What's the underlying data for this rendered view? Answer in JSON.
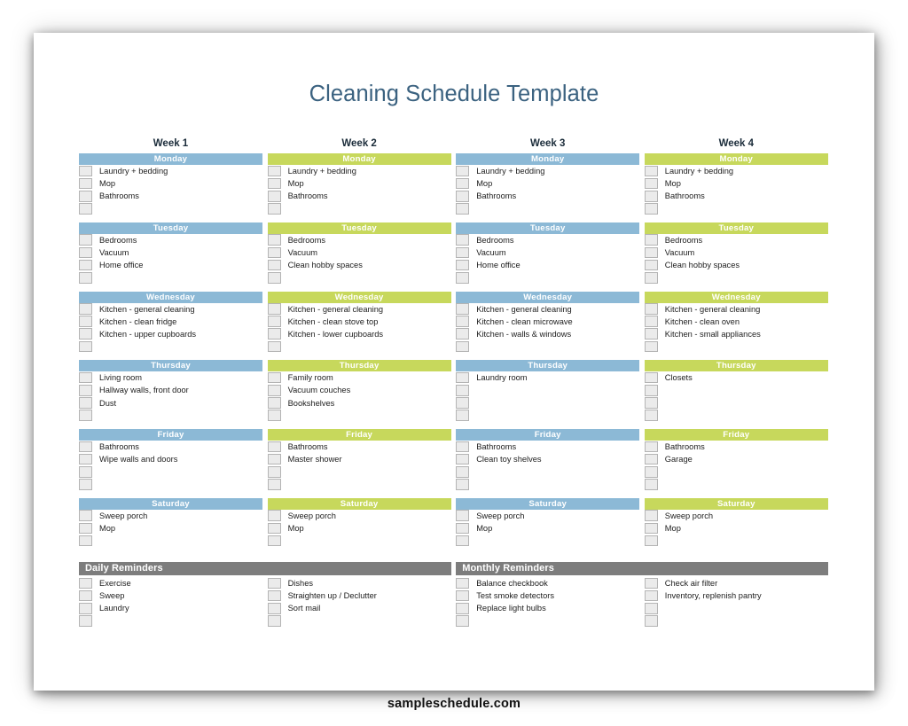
{
  "document": {
    "title": "Cleaning Schedule Template",
    "footer": "sampleschedule.com"
  },
  "colors": {
    "blue": "#8cb9d6",
    "green": "#c7d85c",
    "gray_header": "#7d7d7d",
    "title_text": "#3b6280",
    "checkbox_fill": "#ebebeb",
    "checkbox_border": "#b4b4b4"
  },
  "weeks": [
    {
      "label": "Week 1",
      "theme": "blue",
      "days": [
        {
          "name": "Monday",
          "slots": 4,
          "tasks": [
            "Laundry + bedding",
            "Mop",
            "Bathrooms"
          ]
        },
        {
          "name": "Tuesday",
          "slots": 4,
          "tasks": [
            "Bedrooms",
            "Vacuum",
            "Home office"
          ]
        },
        {
          "name": "Wednesday",
          "slots": 4,
          "tasks": [
            "Kitchen - general cleaning",
            "Kitchen - clean fridge",
            "Kitchen - upper cupboards"
          ]
        },
        {
          "name": "Thursday",
          "slots": 4,
          "tasks": [
            "Living room",
            "Hallway walls, front door",
            "Dust"
          ]
        },
        {
          "name": "Friday",
          "slots": 4,
          "tasks": [
            "Bathrooms",
            "Wipe walls and doors"
          ]
        },
        {
          "name": "Saturday",
          "slots": 3,
          "tasks": [
            "Sweep porch",
            "Mop"
          ]
        }
      ]
    },
    {
      "label": "Week 2",
      "theme": "green",
      "days": [
        {
          "name": "Monday",
          "slots": 4,
          "tasks": [
            "Laundry + bedding",
            "Mop",
            "Bathrooms"
          ]
        },
        {
          "name": "Tuesday",
          "slots": 4,
          "tasks": [
            "Bedrooms",
            "Vacuum",
            "Clean hobby spaces"
          ]
        },
        {
          "name": "Wednesday",
          "slots": 4,
          "tasks": [
            "Kitchen - general cleaning",
            "Kitchen - clean stove top",
            "Kitchen - lower cupboards"
          ]
        },
        {
          "name": "Thursday",
          "slots": 4,
          "tasks": [
            "Family room",
            "Vacuum couches",
            "Bookshelves"
          ]
        },
        {
          "name": "Friday",
          "slots": 4,
          "tasks": [
            "Bathrooms",
            "Master shower"
          ]
        },
        {
          "name": "Saturday",
          "slots": 3,
          "tasks": [
            "Sweep porch",
            "Mop"
          ]
        }
      ]
    },
    {
      "label": "Week 3",
      "theme": "blue",
      "days": [
        {
          "name": "Monday",
          "slots": 4,
          "tasks": [
            "Laundry + bedding",
            "Mop",
            "Bathrooms"
          ]
        },
        {
          "name": "Tuesday",
          "slots": 4,
          "tasks": [
            "Bedrooms",
            "Vacuum",
            "Home office"
          ]
        },
        {
          "name": "Wednesday",
          "slots": 4,
          "tasks": [
            "Kitchen - general cleaning",
            "Kitchen - clean microwave",
            "Kitchen - walls & windows"
          ]
        },
        {
          "name": "Thursday",
          "slots": 4,
          "tasks": [
            "Laundry room"
          ]
        },
        {
          "name": "Friday",
          "slots": 4,
          "tasks": [
            "Bathrooms",
            "Clean toy shelves"
          ]
        },
        {
          "name": "Saturday",
          "slots": 3,
          "tasks": [
            "Sweep porch",
            "Mop"
          ]
        }
      ]
    },
    {
      "label": "Week 4",
      "theme": "green",
      "days": [
        {
          "name": "Monday",
          "slots": 4,
          "tasks": [
            "Laundry + bedding",
            "Mop",
            "Bathrooms"
          ]
        },
        {
          "name": "Tuesday",
          "slots": 4,
          "tasks": [
            "Bedrooms",
            "Vacuum",
            "Clean hobby spaces"
          ]
        },
        {
          "name": "Wednesday",
          "slots": 4,
          "tasks": [
            "Kitchen - general cleaning",
            "Kitchen - clean oven",
            "Kitchen - small appliances"
          ]
        },
        {
          "name": "Thursday",
          "slots": 4,
          "tasks": [
            "Closets"
          ]
        },
        {
          "name": "Friday",
          "slots": 4,
          "tasks": [
            "Bathrooms",
            "Garage"
          ]
        },
        {
          "name": "Saturday",
          "slots": 3,
          "tasks": [
            "Sweep porch",
            "Mop"
          ]
        }
      ]
    }
  ],
  "reminders": [
    {
      "title": "Daily Reminders",
      "columns": [
        {
          "slots": 4,
          "tasks": [
            "Exercise",
            "Sweep",
            "Laundry"
          ]
        },
        {
          "slots": 4,
          "tasks": [
            "Dishes",
            "Straighten up / Declutter",
            "Sort mail"
          ]
        }
      ]
    },
    {
      "title": "Monthly Reminders",
      "columns": [
        {
          "slots": 4,
          "tasks": [
            "Balance checkbook",
            "Test smoke detectors",
            "Replace light bulbs"
          ]
        },
        {
          "slots": 4,
          "tasks": [
            "Check air filter",
            "Inventory, replenish pantry"
          ]
        }
      ]
    }
  ]
}
